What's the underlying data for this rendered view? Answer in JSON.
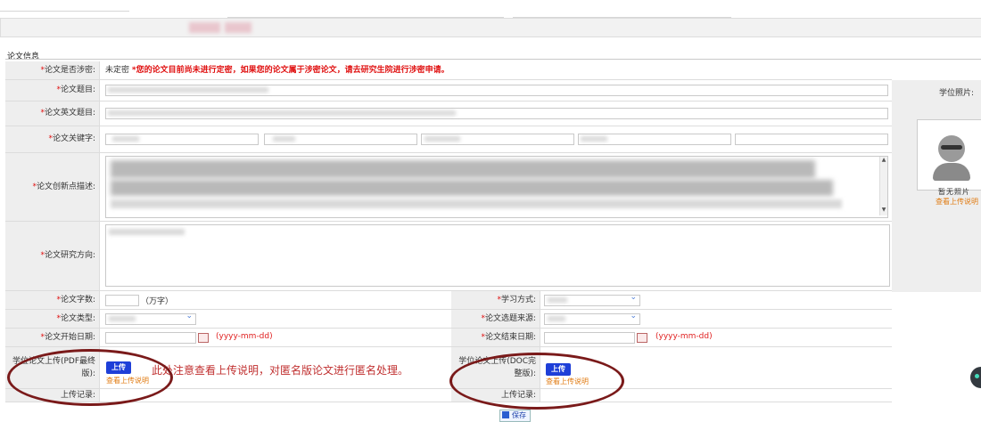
{
  "section": {
    "title": "论文信息"
  },
  "labels": {
    "secret": "论文是否涉密:",
    "title": "论文题目:",
    "title_en": "论文英文题目:",
    "keywords": "论文关键字:",
    "innovation": "论文创新点描述:",
    "direction": "论文研究方向:",
    "word_count": "论文字数:",
    "study_mode": "学习方式:",
    "type": "论文类型:",
    "source": "论文选题来源:",
    "start_date": "论文开始日期:",
    "end_date": "论文结束日期:",
    "pdf_upload": "学位论文上传(PDF最终版):",
    "doc_upload": "学位论文上传(DOC完整版):",
    "upload_record_left": "上传记录:",
    "upload_record_right": "上传记录:"
  },
  "required_mark": "*",
  "secret": {
    "value": "未定密",
    "notice": "*您的论文目前尚未进行定密，如果您的论文属于涉密论文，请去研究生院进行涉密申请。"
  },
  "word_count_unit": "（万字）",
  "date_hint": "(yyyy-mm-dd)",
  "upload": {
    "button": "上传",
    "link": "查看上传说明",
    "annotation": "此处注意查看上传说明，对匿名版论文进行匿名处理。"
  },
  "photo": {
    "label": "学位照片:",
    "placeholder": "暂无照片",
    "link": "查看上传说明"
  },
  "save_button": "保存",
  "colors": {
    "required": "#e01010",
    "upload_button": "#1e3fd8",
    "link": "#e07a10",
    "annotation_ring": "#7a1a1a"
  }
}
